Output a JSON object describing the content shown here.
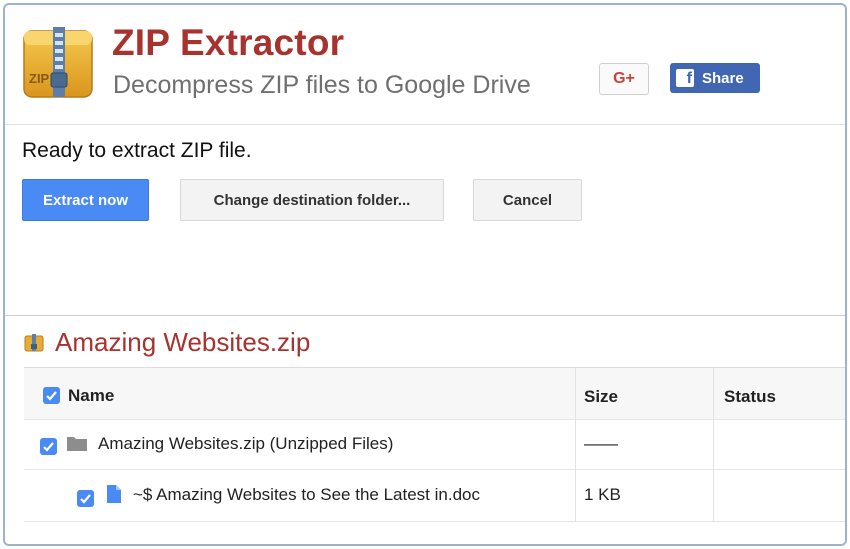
{
  "header": {
    "title": "ZIP Extractor",
    "subtitle": "Decompress ZIP files to Google Drive",
    "logo_text": "ZIP",
    "gplus_label": "G+",
    "share_label": "Share",
    "fb_glyph": "f"
  },
  "status": {
    "message": "Ready to extract ZIP file."
  },
  "actions": {
    "extract_label": "Extract now",
    "change_dest_label": "Change destination folder...",
    "cancel_label": "Cancel"
  },
  "archive": {
    "name": "Amazing Websites.zip",
    "columns": [
      "Name",
      "Size",
      "Status"
    ],
    "rows": [
      {
        "name": "Amazing Websites.zip (Unzipped Files)",
        "size": "——",
        "status": "",
        "type": "folder-icon",
        "checked": true
      },
      {
        "name": "~$ Amazing Websites to See the Latest in.doc",
        "size": "1 KB",
        "status": "",
        "type": "document-icon",
        "checked": true
      }
    ]
  },
  "colors": {
    "brand_red": "#a8322d",
    "primary_blue": "#4a8af4",
    "facebook_blue": "#4267b2"
  }
}
